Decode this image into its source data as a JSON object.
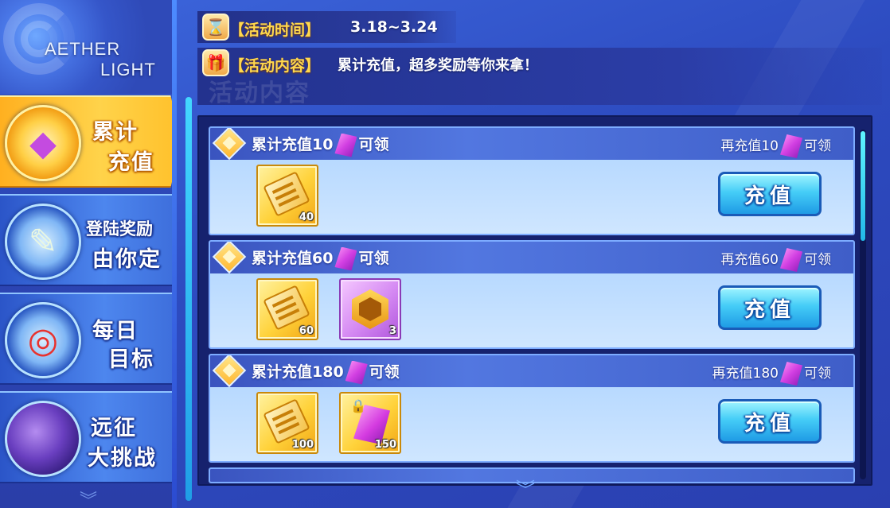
{
  "logo": {
    "line1": "AETHER",
    "line2": "LIGHT"
  },
  "sidebar": {
    "tabs": [
      {
        "line1": "累计",
        "line2": "充值",
        "icon": "gem-chest-icon",
        "active": true
      },
      {
        "line1": "登陆奖励",
        "line2": "由你定",
        "icon": "calendar-checklist-icon",
        "active": false
      },
      {
        "line1": "每日",
        "line2": "目标",
        "icon": "target-dart-icon",
        "active": false
      },
      {
        "line1": "远征",
        "line2": "大挑战",
        "icon": "planet-icon",
        "active": false
      }
    ]
  },
  "header": {
    "time_label": "【活动时间】",
    "time_value": "3.18~3.24",
    "content_label": "【活动内容】",
    "content_value": "累计充值，超多奖励等你来拿！",
    "ghost_title": "活动内容"
  },
  "rewards": [
    {
      "title_prefix": "累计充值10",
      "title_suffix": "可领",
      "right_prefix": "再充值10",
      "right_suffix": "可领",
      "button": "充值",
      "items": [
        {
          "type": "ticket",
          "qty": "40"
        }
      ]
    },
    {
      "title_prefix": "累计充值60",
      "title_suffix": "可领",
      "right_prefix": "再充值60",
      "right_suffix": "可领",
      "button": "充值",
      "items": [
        {
          "type": "ticket",
          "qty": "60"
        },
        {
          "type": "hex-badge",
          "qty": "3"
        }
      ]
    },
    {
      "title_prefix": "累计充值180",
      "title_suffix": "可领",
      "right_prefix": "再充值180",
      "right_suffix": "可领",
      "button": "充值",
      "items": [
        {
          "type": "ticket",
          "qty": "100"
        },
        {
          "type": "locked-gem",
          "qty": "150"
        }
      ]
    }
  ],
  "colors": {
    "accent_gold": "#ffd84d",
    "button_blue": "#45cdf7",
    "gem_purple": "#d23fe2"
  }
}
